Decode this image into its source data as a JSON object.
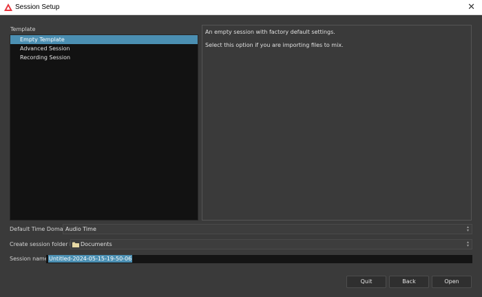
{
  "window": {
    "title": "Session Setup"
  },
  "template": {
    "label": "Template",
    "items": [
      {
        "label": "Empty Template",
        "selected": true
      },
      {
        "label": "Advanced Session",
        "selected": false
      },
      {
        "label": "Recording Session",
        "selected": false
      }
    ]
  },
  "description": {
    "line1": "An empty session with factory default settings.",
    "line2": "Select this option if you are importing files to mix."
  },
  "time_domain": {
    "label": "Default Time Domain:",
    "value": "Audio Time"
  },
  "folder": {
    "label": "Create session folder in:",
    "value": "Documents"
  },
  "session_name": {
    "label": "Session name:",
    "value": "Untitled-2024-05-15-19-50-06"
  },
  "buttons": {
    "quit": "Quit",
    "back": "Back",
    "open": "Open"
  },
  "colors": {
    "accent": "#4b8fb2",
    "background": "#3a3a3a",
    "list_background": "#121212",
    "logo": "#e8343c"
  }
}
